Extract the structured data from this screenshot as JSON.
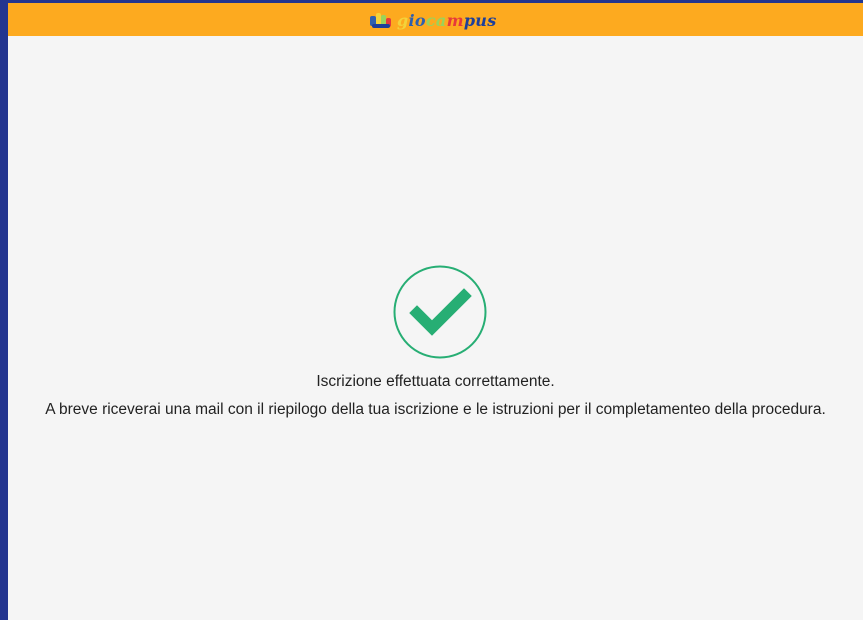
{
  "header": {
    "logo_text": {
      "part1": "g",
      "part2": "io",
      "part3": "ca",
      "part4": "m",
      "part5": "pus"
    },
    "colors": {
      "bar": "#fdaa1f",
      "frame": "#23358f"
    }
  },
  "confirmation": {
    "icon": "check-circle-icon",
    "icon_color": "#27ae74",
    "title": "Iscrizione effettuata correttamente.",
    "body": "A breve riceverai una mail con il riepilogo della tua iscrizione e le istruzioni per il completamenteo della procedura."
  }
}
